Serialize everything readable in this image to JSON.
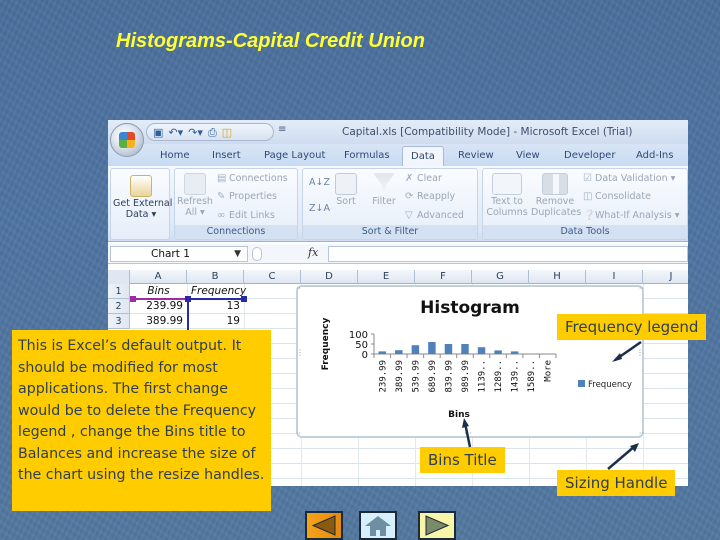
{
  "slide": {
    "title": "Histograms-Capital Credit Union",
    "colors": {
      "background": "#4f74a2",
      "title": "#ffff33",
      "callout": "#ffcc00"
    }
  },
  "excel": {
    "window_title": "Capital.xls  [Compatibility Mode] - Microsoft Excel (Trial)",
    "quick_access": [
      "save-icon",
      "undo-icon",
      "redo-icon",
      "print-preview-icon",
      "open-icon"
    ],
    "tabs": [
      {
        "label": "Home",
        "active": false
      },
      {
        "label": "Insert",
        "active": false
      },
      {
        "label": "Page Layout",
        "active": false
      },
      {
        "label": "Formulas",
        "active": false
      },
      {
        "label": "Data",
        "active": true
      },
      {
        "label": "Review",
        "active": false
      },
      {
        "label": "View",
        "active": false
      },
      {
        "label": "Developer",
        "active": false
      },
      {
        "label": "Add-Ins",
        "active": false
      }
    ],
    "ribbon": {
      "get_external_data": {
        "line1": "Get External",
        "line2": "Data ▾"
      },
      "connections_group": {
        "label": "Connections",
        "refresh_all": {
          "line1": "Refresh",
          "line2": "All ▾"
        },
        "connections": "Connections",
        "properties": "Properties",
        "edit_links": "Edit Links"
      },
      "sort_filter_group": {
        "label": "Sort & Filter",
        "sort_az": "A↓Z",
        "sort_za": "Z↓A",
        "sort": "Sort",
        "filter": "Filter",
        "clear": "Clear",
        "reapply": "Reapply",
        "advanced": "Advanced"
      },
      "data_tools_group": {
        "label": "Data Tools",
        "text_to_columns": {
          "line1": "Text to",
          "line2": "Columns"
        },
        "remove_duplicates": {
          "line1": "Remove",
          "line2": "Duplicates"
        },
        "data_validation": "Data Validation ▾",
        "consolidate": "Consolidate",
        "what_if": "What-If Analysis ▾"
      }
    },
    "name_box": "Chart 1",
    "fx_label": "fx",
    "formula_value": "",
    "columns": [
      "A",
      "B",
      "C",
      "D",
      "E",
      "F",
      "G",
      "H",
      "I",
      "J"
    ],
    "rows": [
      {
        "num": "1",
        "a": "Bins",
        "b": "Frequency"
      },
      {
        "num": "2",
        "a": "239.99",
        "b": "13"
      },
      {
        "num": "3",
        "a": "389.99",
        "b": "19"
      }
    ]
  },
  "chart_data": {
    "type": "bar",
    "title": "Histogram",
    "xlabel": "Bins",
    "ylabel": "Frequency",
    "ylim": [
      0,
      100
    ],
    "yticks": [
      "100",
      "50",
      "0"
    ],
    "categories": [
      "239.99",
      "389.99",
      "539.99",
      "689.99",
      "839.99",
      "989.99",
      "1139...",
      "1289...",
      "1439...",
      "1589...",
      "More"
    ],
    "category_labels": [
      "239.99",
      "389.99",
      "539.99",
      "689.99",
      "839.99",
      "989.99",
      "1139..",
      "1289..",
      "1439..",
      "1589..",
      "More"
    ],
    "series": [
      {
        "name": "Frequency",
        "color": "#4f81bd",
        "values": [
          13,
          19,
          44,
          60,
          50,
          50,
          34,
          18,
          13,
          0,
          0
        ]
      }
    ],
    "legend": {
      "entries": [
        "Frequency"
      ],
      "position": "right"
    }
  },
  "callouts": {
    "main": "This is Excel’s default output. It should be modified for most applications.  The first change would be to delete the Frequency legend , change the Bins title to Balances and increase the size of the chart using the resize handles.",
    "frequency_legend": "Frequency legend",
    "bins_title": "Bins Title",
    "sizing_handle": "Sizing Handle"
  },
  "navigation": {
    "prev": "previous-slide",
    "home": "home",
    "next": "next-slide"
  }
}
